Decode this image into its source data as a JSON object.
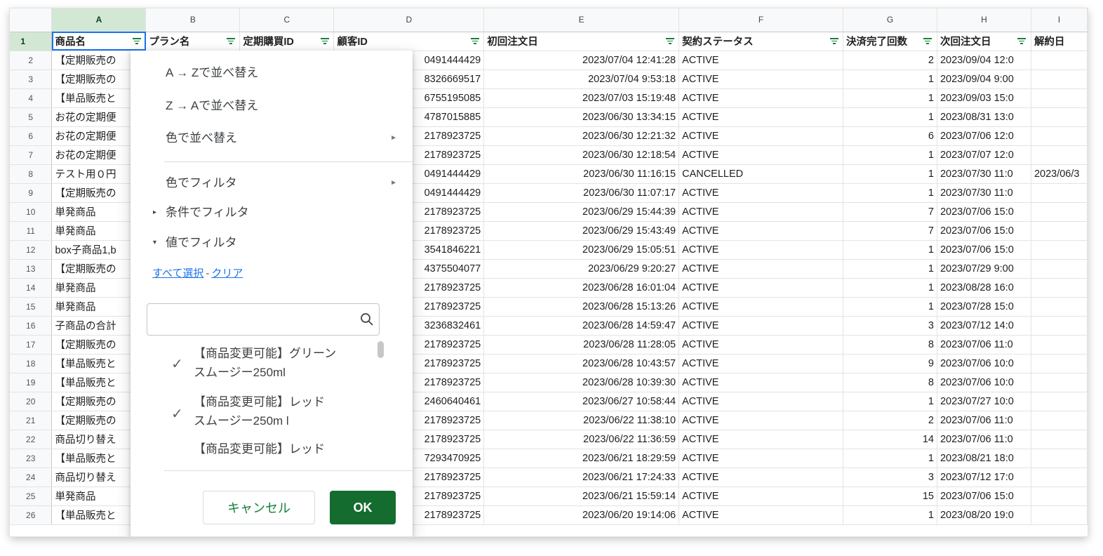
{
  "columns": [
    "A",
    "B",
    "C",
    "D",
    "E",
    "F",
    "G",
    "H",
    "I"
  ],
  "header_row": {
    "num": "1",
    "cells": [
      "商品名",
      "プラン名",
      "定期購買ID",
      "顧客ID",
      "初回注文日",
      "契約ステータス",
      "決済完了回数",
      "次回注文日",
      "解約日"
    ]
  },
  "rows": [
    {
      "num": "2",
      "a": "【定期販売の",
      "d": "0491444429",
      "e": "2023/07/04 12:41:28",
      "f": "ACTIVE",
      "g": "2",
      "h": "2023/09/04 12:0",
      "i": ""
    },
    {
      "num": "3",
      "a": "【定期販売の",
      "d": "8326669517",
      "e": "2023/07/04 9:53:18",
      "f": "ACTIVE",
      "g": "1",
      "h": "2023/09/04 9:00",
      "i": ""
    },
    {
      "num": "4",
      "a": "【単品販売と",
      "d": "6755195085",
      "e": "2023/07/03 15:19:48",
      "f": "ACTIVE",
      "g": "1",
      "h": "2023/09/03 15:0",
      "i": ""
    },
    {
      "num": "5",
      "a": "お花の定期便",
      "d": "4787015885",
      "e": "2023/06/30 13:34:15",
      "f": "ACTIVE",
      "g": "1",
      "h": "2023/08/31 13:0",
      "i": ""
    },
    {
      "num": "6",
      "a": "お花の定期便",
      "d": "2178923725",
      "e": "2023/06/30 12:21:32",
      "f": "ACTIVE",
      "g": "6",
      "h": "2023/07/06 12:0",
      "i": ""
    },
    {
      "num": "7",
      "a": "お花の定期便",
      "d": "2178923725",
      "e": "2023/06/30 12:18:54",
      "f": "ACTIVE",
      "g": "1",
      "h": "2023/07/07 12:0",
      "i": ""
    },
    {
      "num": "8",
      "a": "テスト用０円",
      "d": "0491444429",
      "e": "2023/06/30 11:16:15",
      "f": "CANCELLED",
      "g": "1",
      "h": "2023/07/30 11:0",
      "i": "2023/06/3"
    },
    {
      "num": "9",
      "a": "【定期販売の",
      "d": "0491444429",
      "e": "2023/06/30 11:07:17",
      "f": "ACTIVE",
      "g": "1",
      "h": "2023/07/30 11:0",
      "i": ""
    },
    {
      "num": "10",
      "a": "単発商品",
      "d": "2178923725",
      "e": "2023/06/29 15:44:39",
      "f": "ACTIVE",
      "g": "7",
      "h": "2023/07/06 15:0",
      "i": ""
    },
    {
      "num": "11",
      "a": "単発商品",
      "d": "2178923725",
      "e": "2023/06/29 15:43:49",
      "f": "ACTIVE",
      "g": "7",
      "h": "2023/07/06 15:0",
      "i": ""
    },
    {
      "num": "12",
      "a": "box子商品1,b",
      "d": "3541846221",
      "e": "2023/06/29 15:05:51",
      "f": "ACTIVE",
      "g": "1",
      "h": "2023/07/06 15:0",
      "i": ""
    },
    {
      "num": "13",
      "a": "【定期販売の",
      "d": "4375504077",
      "e": "2023/06/29 9:20:27",
      "f": "ACTIVE",
      "g": "1",
      "h": "2023/07/29 9:00",
      "i": ""
    },
    {
      "num": "14",
      "a": "単発商品",
      "d": "2178923725",
      "e": "2023/06/28 16:01:04",
      "f": "ACTIVE",
      "g": "1",
      "h": "2023/08/28 16:0",
      "i": ""
    },
    {
      "num": "15",
      "a": "単発商品",
      "d": "2178923725",
      "e": "2023/06/28 15:13:26",
      "f": "ACTIVE",
      "g": "1",
      "h": "2023/07/28 15:0",
      "i": ""
    },
    {
      "num": "16",
      "a": "子商品の合計",
      "d": "3236832461",
      "e": "2023/06/28 14:59:47",
      "f": "ACTIVE",
      "g": "3",
      "h": "2023/07/12 14:0",
      "i": ""
    },
    {
      "num": "17",
      "a": "【定期販売の",
      "d": "2178923725",
      "e": "2023/06/28 11:28:05",
      "f": "ACTIVE",
      "g": "8",
      "h": "2023/07/06 11:0",
      "i": ""
    },
    {
      "num": "18",
      "a": "【単品販売と",
      "d": "2178923725",
      "e": "2023/06/28 10:43:57",
      "f": "ACTIVE",
      "g": "9",
      "h": "2023/07/06 10:0",
      "i": ""
    },
    {
      "num": "19",
      "a": "【単品販売と",
      "d": "2178923725",
      "e": "2023/06/28 10:39:30",
      "f": "ACTIVE",
      "g": "8",
      "h": "2023/07/06 10:0",
      "i": ""
    },
    {
      "num": "20",
      "a": "【定期販売の",
      "d": "2460640461",
      "e": "2023/06/27 10:58:44",
      "f": "ACTIVE",
      "g": "1",
      "h": "2023/07/27 10:0",
      "i": ""
    },
    {
      "num": "21",
      "a": "【定期販売の",
      "d": "2178923725",
      "e": "2023/06/22 11:38:10",
      "f": "ACTIVE",
      "g": "2",
      "h": "2023/07/06 11:0",
      "i": ""
    },
    {
      "num": "22",
      "a": "商品切り替え",
      "d": "2178923725",
      "e": "2023/06/22 11:36:59",
      "f": "ACTIVE",
      "g": "14",
      "h": "2023/07/06 11:0",
      "i": ""
    },
    {
      "num": "23",
      "a": "【単品販売と",
      "d": "7293470925",
      "e": "2023/06/21 18:29:59",
      "f": "ACTIVE",
      "g": "1",
      "h": "2023/08/21 18:0",
      "i": ""
    },
    {
      "num": "24",
      "a": "商品切り替え",
      "d": "2178923725",
      "e": "2023/06/21 17:24:33",
      "f": "ACTIVE",
      "g": "3",
      "h": "2023/07/12 17:0",
      "i": ""
    },
    {
      "num": "25",
      "a": "単発商品",
      "d": "2178923725",
      "e": "2023/06/21 15:59:14",
      "f": "ACTIVE",
      "g": "15",
      "h": "2023/07/06 15:0",
      "i": ""
    },
    {
      "num": "26",
      "a": "【単品販売と",
      "d": "2178923725",
      "e": "2023/06/20 19:14:06",
      "f": "ACTIVE",
      "g": "1",
      "h": "2023/08/20 19:0",
      "i": ""
    }
  ],
  "filter_menu": {
    "sort_asc": "A → Zで並べ替え",
    "sort_desc": "Z → Aで並べ替え",
    "sort_color": "色で並べ替え",
    "filter_color": "色でフィルタ",
    "filter_condition": "条件でフィルタ",
    "filter_values": "値でフィルタ",
    "select_all": "すべて選択",
    "clear": "クリア",
    "search_placeholder": "",
    "values": [
      {
        "line1": "【商品変更可能】グリーン",
        "line2": "スムージー250ml",
        "checked": true
      },
      {
        "line1": "【商品変更可能】レッド",
        "line2": "スムージー250m l",
        "checked": true
      },
      {
        "line1": "【商品変更可能】レッド",
        "line2": "",
        "checked": false
      }
    ],
    "cancel": "キャンセル",
    "ok": "OK"
  }
}
